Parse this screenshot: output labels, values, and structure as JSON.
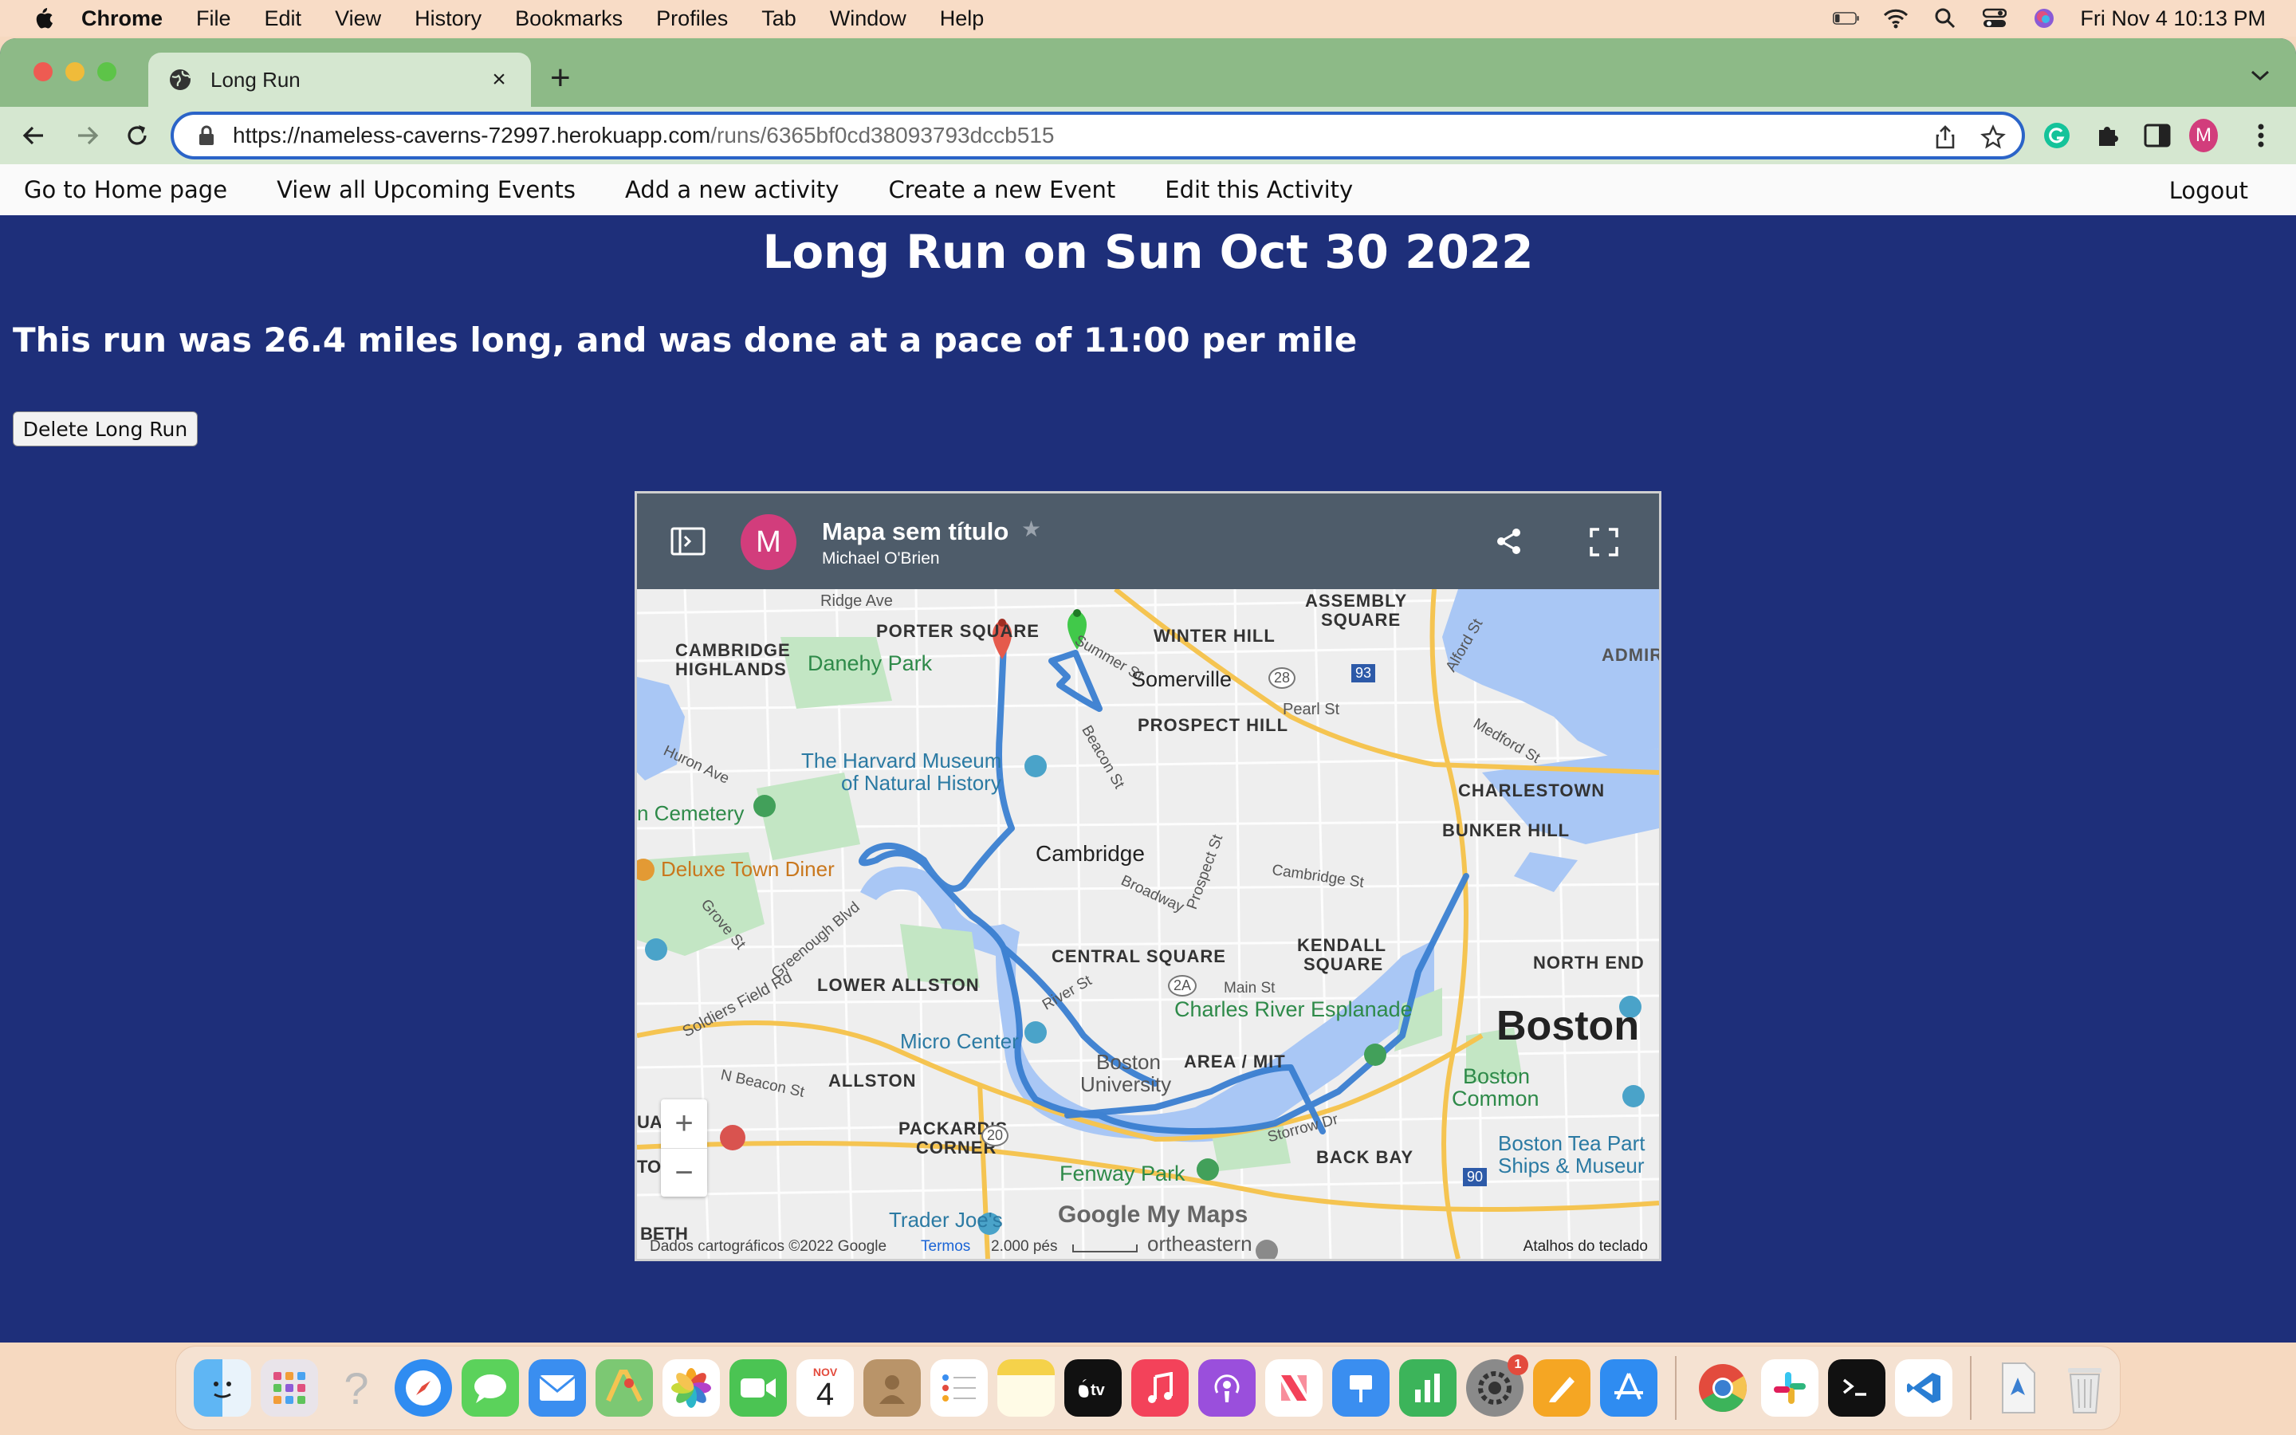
{
  "menubar": {
    "app": "Chrome",
    "items": [
      "File",
      "Edit",
      "View",
      "History",
      "Bookmarks",
      "Profiles",
      "Tab",
      "Window",
      "Help"
    ],
    "clock": "Fri Nov 4  10:13 PM",
    "icons": [
      "battery-icon",
      "wifi-icon",
      "spotlight-search-icon",
      "control-center-icon",
      "siri-icon"
    ]
  },
  "browser": {
    "tab_title": "Long Run",
    "url_host": "https://nameless-caverns-72997.herokuapp.com",
    "url_path": "/runs/6365bf0cd38093793dccb515",
    "profile_initial": "M",
    "new_tab_label": "+",
    "close_tab_label": "×"
  },
  "site_nav": {
    "home": "Go to Home page",
    "events": "View all Upcoming Events",
    "add_activity": "Add a new activity",
    "create_event": "Create a new Event",
    "edit_activity": "Edit this Activity",
    "logout": "Logout"
  },
  "page": {
    "title": "Long Run on Sun Oct 30 2022",
    "summary": "This run was 26.4 miles long, and was done at a pace of 11:00 per mile",
    "delete_label": "Delete Long Run"
  },
  "map": {
    "title": "Mapa sem título",
    "owner": "Michael O'Brien",
    "owner_initial": "M",
    "star": "★",
    "zoom_in": "+",
    "zoom_out": "−",
    "branding": "Google My Maps",
    "attribution": "Dados cartográficos ©2022 Google",
    "terms": "Termos",
    "scale": "2.000 pés",
    "shortcuts": "Atalhos do teclado",
    "colors": {
      "water": "#a9c7f5",
      "park": "#c3e6c4",
      "land": "#eeeeee",
      "route": "#3a7fd1",
      "highway": "#f5c451"
    },
    "labels": {
      "ridge_ave": "Ridge Ave",
      "porter_square": "PORTER SQUARE",
      "winter_hill": "WINTER HILL",
      "assembly_square_1": "ASSEMBLY",
      "assembly_square_2": "SQUARE",
      "cambridge_highlands_1": "CAMBRIDGE",
      "cambridge_highlands_2": "HIGHLANDS",
      "danehy_park": "Danehy Park",
      "somerville": "Somerville",
      "prospect_hill": "PROSPECT HILL",
      "pearl_st": "Pearl St",
      "harvard_museum_1": "The Harvard Museum",
      "harvard_museum_2": "of Natural History",
      "charlestown": "CHARLESTOWN",
      "bunker_hill": "BUNKER HILL",
      "cemetery": "n Cemetery",
      "cambridge": "Cambridge",
      "deluxe_town_diner": "Deluxe Town Diner",
      "central_square": "CENTRAL SQUARE",
      "kendall_square_1": "KENDALL",
      "kendall_square_2": "SQUARE",
      "north_end": "NORTH END",
      "lower_allston": "LOWER ALLSTON",
      "charles_river_esplanade": "Charles River Esplanade",
      "boston": "Boston",
      "micro_center": "Micro Center",
      "boston_university_1": "Boston",
      "boston_university_2": "University",
      "mit": "AREA / MIT",
      "allston": "ALLSTON",
      "boston_common_1": "Boston",
      "boston_common_2": "Common",
      "packards_corner_1": "PACKARD'S",
      "packards_corner_2": "CORNER",
      "back_bay": "BACK BAY",
      "fenway_park": "Fenway Park",
      "tea_party_1": "Boston Tea Part",
      "tea_party_2": "Ships & Museur",
      "trader_joes": "Trader Joe's",
      "northeastern": "ortheastern",
      "beacon_st": "Beacon St",
      "broadway": "Broadway",
      "cambridge_st": "Cambridge St",
      "soldiers_field": "Soldiers Field Rd",
      "n_beacon_st": "N Beacon St",
      "huron_ave": "Huron Ave",
      "grove_st": "Grove St",
      "greenough_blvd": "Greenough Blvd",
      "main_st": "Main St",
      "river_st": "River St",
      "storrow_dr": "Storrow Dr",
      "admiral": "ADMIR",
      "medford_st": "Medford St",
      "summer_st": "Summer St",
      "alford_st": "Alford St",
      "prospect_st": "Prospect St",
      "uare": "UARE",
      "ton": "TON",
      "beth": "BETH",
      "route_28": "28",
      "route_93": "93",
      "route_2a": "2A",
      "route_20": "20",
      "route_90": "90"
    }
  },
  "dock": {
    "apps": [
      "Finder",
      "Launchpad",
      "Help",
      "Safari",
      "Messages",
      "Mail",
      "Maps",
      "Photos",
      "FaceTime",
      "Calendar",
      "Contacts",
      "Reminders",
      "Notes",
      "TV",
      "Music",
      "Podcasts",
      "News",
      "Keynote",
      "Numbers",
      "System Preferences",
      "Pages",
      "App Store",
      "Chrome",
      "Slack",
      "Terminal",
      "VS Code",
      "Downloads",
      "Trash"
    ],
    "calendar_month": "NOV",
    "calendar_day": "4",
    "settings_badge": "1"
  }
}
